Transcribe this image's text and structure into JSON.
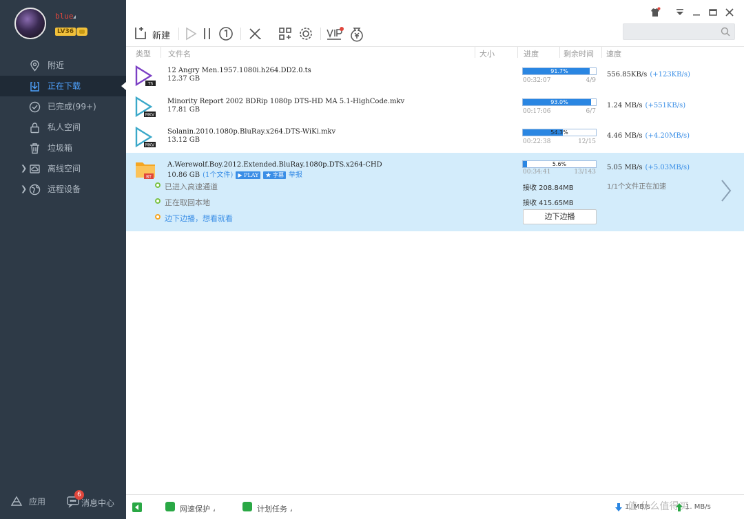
{
  "profile": {
    "username": "blue",
    "level": "LV36"
  },
  "nav": {
    "items": [
      {
        "label": "附近",
        "icon": "location-pin-icon"
      },
      {
        "label": "正在下载",
        "icon": "download-icon"
      },
      {
        "label": "已完成(99+)",
        "icon": "check-circle-icon"
      },
      {
        "label": "私人空间",
        "icon": "lock-icon"
      },
      {
        "label": "垃圾箱",
        "icon": "trash-icon"
      },
      {
        "label": "离线空间",
        "icon": "cloud-folder-icon"
      },
      {
        "label": "远程设备",
        "icon": "globe-icon"
      }
    ]
  },
  "sidebar_bottom": {
    "apps_label": "应用",
    "messages_label": "消息中心",
    "messages_badge": "6"
  },
  "toolbar": {
    "new_label": "新建"
  },
  "columns": {
    "type": "类型",
    "filename": "文件名",
    "size": "大小",
    "progress": "进度",
    "remaining": "剩余时间",
    "speed": "速度"
  },
  "downloads": [
    {
      "name": "12 Angry Men.1957.1080i.h264.DD2.0.ts",
      "size": "12.37 GB",
      "ext": "TS",
      "progress_pct": 91.7,
      "progress_label": "91.7%",
      "elapsed": "00:32:07",
      "pieces": "4/9",
      "speed": "556.85KB/s",
      "boost": "(+123KB/s)",
      "icon_color": "#7b3fc4"
    },
    {
      "name": "Minority Report 2002 BDRip 1080p DTS-HD MA 5.1-HighCode.mkv",
      "size": "17.81 GB",
      "ext": "MKV",
      "progress_pct": 93.0,
      "progress_label": "93.0%",
      "elapsed": "00:17:06",
      "pieces": "6/7",
      "speed": "1.24  MB/s",
      "boost": "(+551KB/s)",
      "icon_color": "#3aa8c9"
    },
    {
      "name": "Solanin.2010.1080p.BluRay.x264.DTS-WiKi.mkv",
      "size": "13.12 GB",
      "ext": "MKV",
      "progress_pct": 54.3,
      "progress_label": "54.3%",
      "elapsed": "00:22:38",
      "pieces": "12/15",
      "speed": "4.46  MB/s",
      "boost": "(+4.20MB/s)",
      "icon_color": "#3aa8c9"
    },
    {
      "name": "A.Werewolf.Boy.2012.Extended.BluRay.1080p.DTS.x264-CHD",
      "size": "10.86 GB",
      "ext": "BT",
      "file_count": "(1个文件)",
      "play_tag": "PLAY",
      "subtitle_tag": "字幕",
      "report": "举报",
      "progress_pct": 5.6,
      "progress_label": "5.6%",
      "elapsed": "00:34:41",
      "pieces": "13/143",
      "speed": "5.05  MB/s",
      "boost": "(+5.03MB/s)",
      "icon_color": "#f5a623",
      "status_lines": [
        "已进入高速通道",
        "正在取回本地",
        "边下边播，想看就看"
      ],
      "recv_1": "接收 208.84MB",
      "recv_2": "接收 415.65MB",
      "play_button": "边下边播",
      "accel_note": "1/1个文件正在加速"
    }
  ],
  "statusbar": {
    "net_protect": "网速保护",
    "schedule": "计划任务",
    "down_rate": "1.   MB/s",
    "up_rate": "1.   MB/s",
    "watermark": "值 什么值得买"
  }
}
